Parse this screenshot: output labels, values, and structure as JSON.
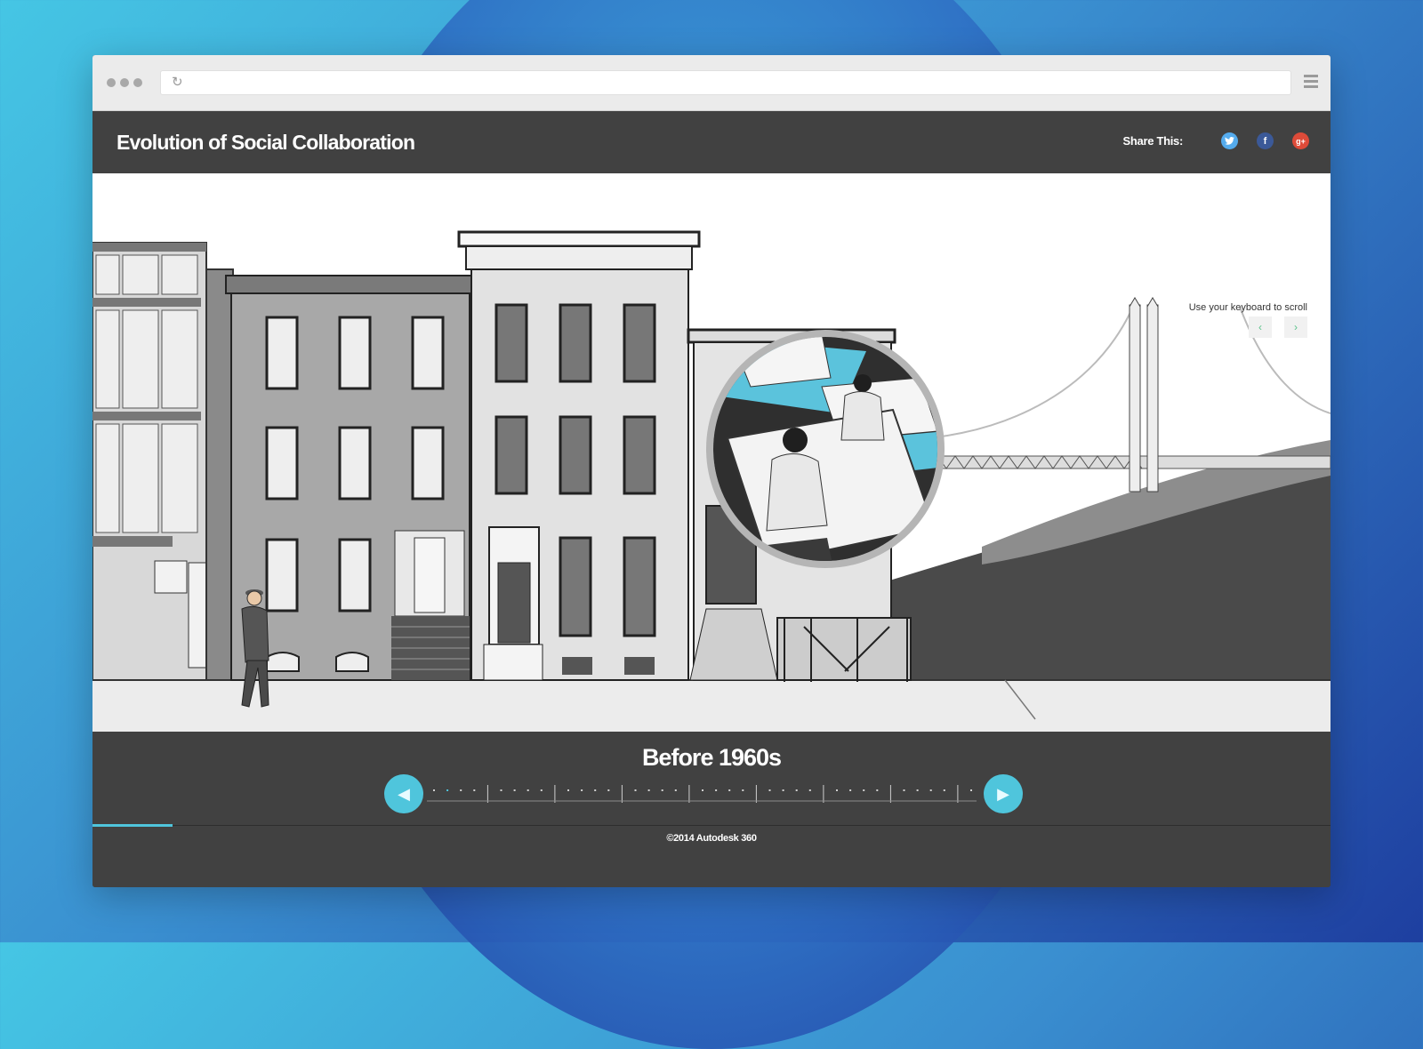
{
  "header": {
    "title": "Evolution of Social Collaboration",
    "share_label": "Share This:",
    "social": [
      {
        "icon": "twitter-icon",
        "color": "#55acee"
      },
      {
        "icon": "facebook-icon",
        "glyph": "f",
        "color": "#3b5998"
      },
      {
        "icon": "google-plus-icon",
        "glyph": "g+",
        "color": "#dd4b39"
      }
    ]
  },
  "scene": {
    "keyboard_hint": "Use your keyboard to scroll",
    "prev_glyph": "‹",
    "next_glyph": "›"
  },
  "timeline": {
    "era_label": "Before 1960s",
    "prev_glyph": "◀",
    "next_glyph": "▶",
    "accent_color": "#4fc5dc",
    "current_position": 1,
    "progress": 0.065
  },
  "footer": {
    "copyright": "©2014 Autodesk 360"
  }
}
